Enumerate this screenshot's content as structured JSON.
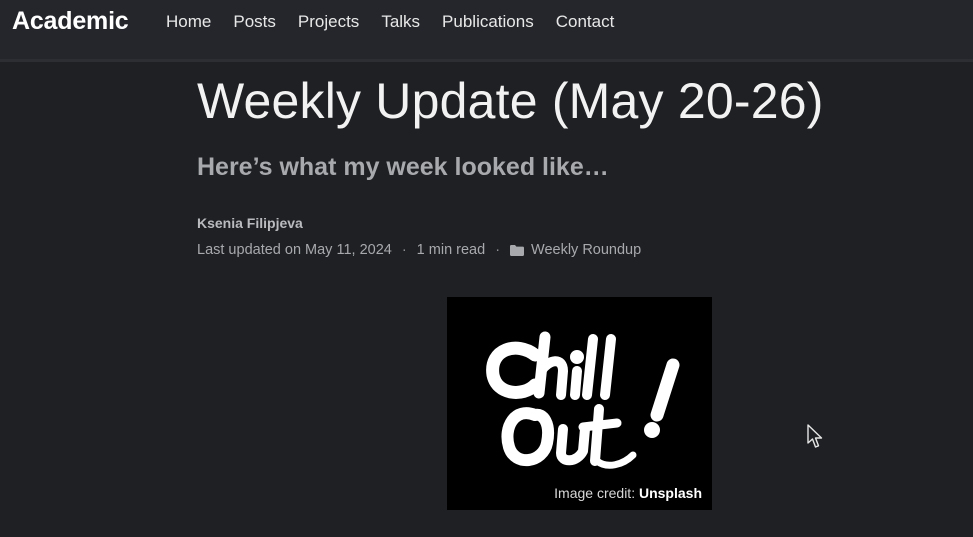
{
  "header": {
    "brand": "Academic",
    "nav": [
      {
        "label": "Home"
      },
      {
        "label": "Posts"
      },
      {
        "label": "Projects"
      },
      {
        "label": "Talks"
      },
      {
        "label": "Publications"
      },
      {
        "label": "Contact"
      }
    ]
  },
  "post": {
    "title": "Weekly Update (May 20-26)",
    "subtitle": "Here’s what my week looked like…",
    "author": "Ksenia Filipjeva",
    "last_updated": "Last updated on May 11, 2024",
    "separator": "·",
    "read_time": "1 min read",
    "category": "Weekly Roundup",
    "category_icon": "folder-icon"
  },
  "image": {
    "artwork_text": "Chill Out!",
    "credit_prefix": "Image credit: ",
    "credit_source": "Unsplash"
  },
  "colors": {
    "background": "#1e2023",
    "navbar": "#24262c",
    "title": "#f2f2f2",
    "muted_text": "#a7a9ad"
  }
}
